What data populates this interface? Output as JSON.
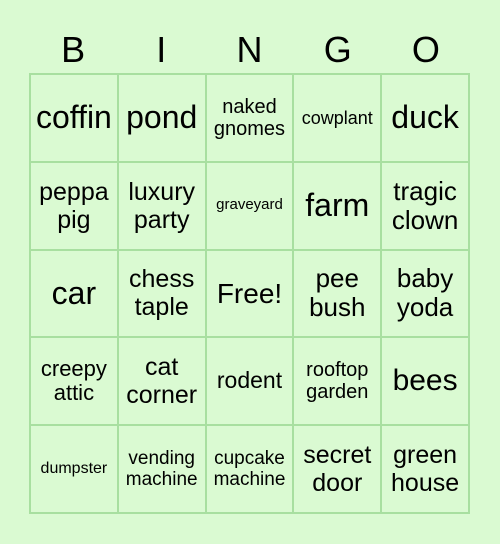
{
  "header": [
    "B",
    "I",
    "N",
    "G",
    "O"
  ],
  "cells": [
    "coffin",
    "pond",
    "naked gnomes",
    "cowplant",
    "duck",
    "peppa pig",
    "luxury party",
    "graveyard",
    "farm",
    "tragic clown",
    "car",
    "chess taple",
    "Free!",
    "pee bush",
    "baby yoda",
    "creepy attic",
    "cat corner",
    "rodent",
    "rooftop garden",
    "bees",
    "dumpster",
    "vending machine",
    "cupcake machine",
    "secret door",
    "green house"
  ],
  "colors": {
    "background": "#dafad2",
    "border": "#a8dfa0",
    "text": "#000000"
  }
}
